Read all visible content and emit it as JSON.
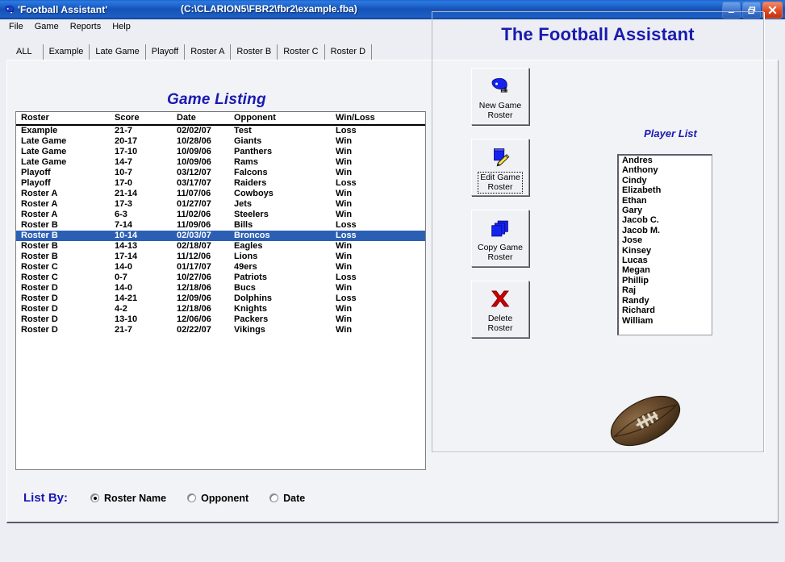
{
  "window": {
    "title": "'Football Assistant'",
    "path": "(C:\\CLARION5\\FBR2\\fbr2\\example.fba)",
    "icon": "football-helmet-icon",
    "minimize_label": "–",
    "restore_label": "❐",
    "close_label": "✕"
  },
  "menu": {
    "items": [
      "File",
      "Game",
      "Reports",
      "Help"
    ]
  },
  "tabs": {
    "active": "ALL",
    "items": [
      "ALL",
      "Example",
      "Late Game",
      "Playoff",
      "Roster A",
      "Roster B",
      "Roster C",
      "Roster D"
    ]
  },
  "game_listing": {
    "title": "Game Listing",
    "columns": [
      "Roster",
      "Score",
      "Date",
      "Opponent",
      "Win/Loss"
    ],
    "selected_index": 10,
    "rows": [
      {
        "roster": "Example",
        "score": "21-7",
        "date": "02/02/07",
        "opponent": "Test",
        "result": "Loss"
      },
      {
        "roster": "Late Game",
        "score": "20-17",
        "date": "10/28/06",
        "opponent": "Giants",
        "result": "Win"
      },
      {
        "roster": "Late Game",
        "score": "17-10",
        "date": "10/09/06",
        "opponent": "Panthers",
        "result": "Win"
      },
      {
        "roster": "Late Game",
        "score": "14-7",
        "date": "10/09/06",
        "opponent": "Rams",
        "result": "Win"
      },
      {
        "roster": "Playoff",
        "score": "10-7",
        "date": "03/12/07",
        "opponent": "Falcons",
        "result": "Win"
      },
      {
        "roster": "Playoff",
        "score": "17-0",
        "date": "03/17/07",
        "opponent": "Raiders",
        "result": "Loss"
      },
      {
        "roster": "Roster A",
        "score": "21-14",
        "date": "11/07/06",
        "opponent": "Cowboys",
        "result": "Win"
      },
      {
        "roster": "Roster A",
        "score": "17-3",
        "date": "01/27/07",
        "opponent": "Jets",
        "result": "Win"
      },
      {
        "roster": "Roster A",
        "score": "6-3",
        "date": "11/02/06",
        "opponent": "Steelers",
        "result": "Win"
      },
      {
        "roster": "Roster B",
        "score": "7-14",
        "date": "11/09/06",
        "opponent": "Bills",
        "result": "Loss"
      },
      {
        "roster": "Roster B",
        "score": "10-14",
        "date": "02/03/07",
        "opponent": "Broncos",
        "result": "Loss"
      },
      {
        "roster": "Roster B",
        "score": "14-13",
        "date": "02/18/07",
        "opponent": "Eagles",
        "result": "Win"
      },
      {
        "roster": "Roster B",
        "score": "17-14",
        "date": "11/12/06",
        "opponent": "Lions",
        "result": "Win"
      },
      {
        "roster": "Roster C",
        "score": "14-0",
        "date": "01/17/07",
        "opponent": "49ers",
        "result": "Win"
      },
      {
        "roster": "Roster C",
        "score": "0-7",
        "date": "10/27/06",
        "opponent": "Patriots",
        "result": "Loss"
      },
      {
        "roster": "Roster D",
        "score": "14-0",
        "date": "12/18/06",
        "opponent": "Bucs",
        "result": "Win"
      },
      {
        "roster": "Roster D",
        "score": "14-21",
        "date": "12/09/06",
        "opponent": "Dolphins",
        "result": "Loss"
      },
      {
        "roster": "Roster D",
        "score": "4-2",
        "date": "12/18/06",
        "opponent": "Knights",
        "result": "Win"
      },
      {
        "roster": "Roster D",
        "score": "13-10",
        "date": "12/06/06",
        "opponent": "Packers",
        "result": "Win"
      },
      {
        "roster": "Roster D",
        "score": "21-7",
        "date": "02/22/07",
        "opponent": "Vikings",
        "result": "Win"
      }
    ]
  },
  "list_by": {
    "label": "List By:",
    "selected": "Roster Name",
    "options": [
      "Roster Name",
      "Opponent",
      "Date"
    ]
  },
  "right_panel": {
    "title": "The Football Assistant",
    "buttons": [
      {
        "line1": "New Game",
        "line2": "Roster",
        "icon": "helmet-icon",
        "focused": false
      },
      {
        "line1": "Edit Game",
        "line2": "Roster",
        "icon": "pencil-edit-icon",
        "focused": true
      },
      {
        "line1": "Copy Game",
        "line2": "Roster",
        "icon": "copy-pages-icon",
        "focused": false
      },
      {
        "line1": "Delete",
        "line2": "Roster",
        "icon": "red-x-icon",
        "focused": false
      }
    ],
    "player_list": {
      "title": "Player List",
      "players": [
        "Andres",
        "Anthony",
        "Cindy",
        "Elizabeth",
        "Ethan",
        "Gary",
        "Jacob C.",
        "Jacob M.",
        "Jose",
        "Kinsey",
        "Lucas",
        "Megan",
        "Phillip",
        "Raj",
        "Randy",
        "Richard",
        "William"
      ]
    },
    "decoration": "football-image"
  },
  "colors": {
    "title_blue": "#1a1ab0",
    "selection_blue": "#2b5fb4",
    "titlebar_blue": "#1652b8",
    "face": "#f2f3f7"
  }
}
